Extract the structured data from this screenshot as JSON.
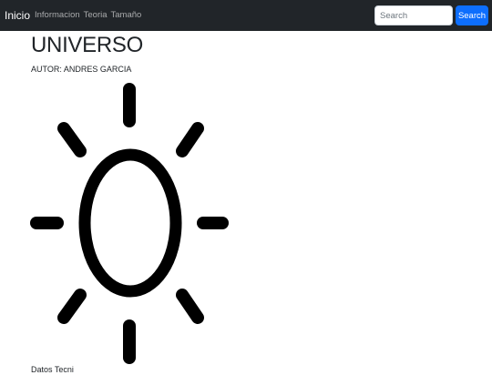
{
  "navbar": {
    "brand": "Inicio",
    "links": [
      "Informacion",
      "Teoria",
      "Tamaño"
    ],
    "search_placeholder": "Search",
    "search_button": "Search"
  },
  "main": {
    "title": "UNIVERSO",
    "author": "AUTOR: ANDRES GARCIA",
    "illustration_icon": "sun-icon",
    "cutoff_text": "Datos Tecni"
  },
  "colors": {
    "navbar_bg": "#212529",
    "accent": "#0d6efd",
    "icon": "#000000"
  }
}
